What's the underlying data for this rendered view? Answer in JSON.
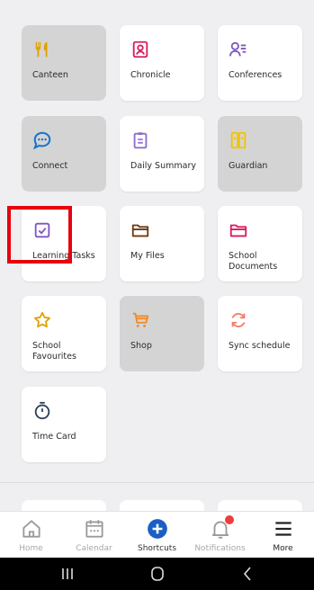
{
  "tiles": [
    {
      "label": "Canteen",
      "icon": "fork-knife-icon",
      "disabled": true
    },
    {
      "label": "Chronicle",
      "icon": "portrait-icon",
      "disabled": false
    },
    {
      "label": "Conferences",
      "icon": "person-list-icon",
      "disabled": false
    },
    {
      "label": "Connect",
      "icon": "chat-bubble-icon",
      "disabled": true
    },
    {
      "label": "Daily Summary",
      "icon": "clipboard-icon",
      "disabled": false
    },
    {
      "label": "Guardian",
      "icon": "guardian-icon",
      "disabled": true
    },
    {
      "label": "Learning Tasks",
      "icon": "checkbox-icon",
      "disabled": false
    },
    {
      "label": "My Files",
      "icon": "folder-brown-icon",
      "disabled": false
    },
    {
      "label": "School Documents",
      "icon": "folder-pink-icon",
      "disabled": false
    },
    {
      "label": "School Favourites",
      "icon": "star-icon",
      "disabled": false
    },
    {
      "label": "Shop",
      "icon": "cart-icon",
      "disabled": true
    },
    {
      "label": "Sync schedule",
      "icon": "sync-icon",
      "disabled": false
    },
    {
      "label": "Time Card",
      "icon": "stopwatch-icon",
      "disabled": false
    }
  ],
  "tabs": [
    {
      "label": "Home",
      "icon": "home-icon"
    },
    {
      "label": "Calendar",
      "icon": "calendar-icon"
    },
    {
      "label": "Shortcuts",
      "icon": "plus-circle-icon"
    },
    {
      "label": "Notifications",
      "icon": "bell-icon"
    },
    {
      "label": "More",
      "icon": "menu-icon"
    }
  ],
  "colors": {
    "background": "#efeff1",
    "tile": "#ffffff",
    "tile_disabled": "#d4d4d4",
    "accent_blue": "#1a73c9",
    "highlight": "#e8000d",
    "badge": "#f03c3c"
  }
}
